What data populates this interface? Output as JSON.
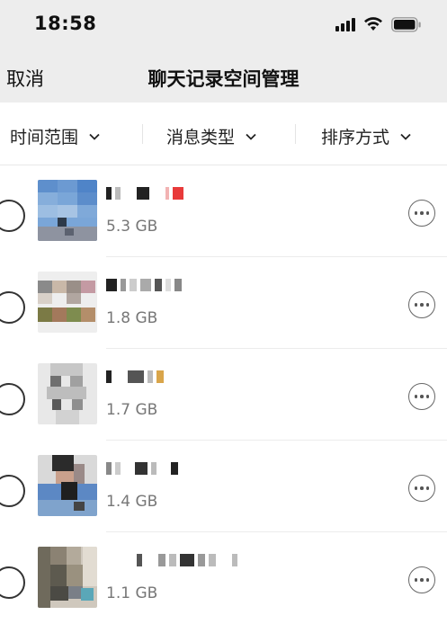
{
  "status_bar": {
    "time": "18:58"
  },
  "nav": {
    "cancel_label": "取消",
    "title": "聊天记录空间管理"
  },
  "filters": [
    {
      "label": "时间范围"
    },
    {
      "label": "消息类型"
    },
    {
      "label": "排序方式"
    }
  ],
  "items": [
    {
      "size": "5.3 GB"
    },
    {
      "size": "1.8 GB"
    },
    {
      "size": "1.7 GB"
    },
    {
      "size": "1.4 GB"
    },
    {
      "size": "1.1 GB"
    }
  ],
  "colors": {
    "header_bg": "#ededed",
    "size_text": "#777777"
  }
}
